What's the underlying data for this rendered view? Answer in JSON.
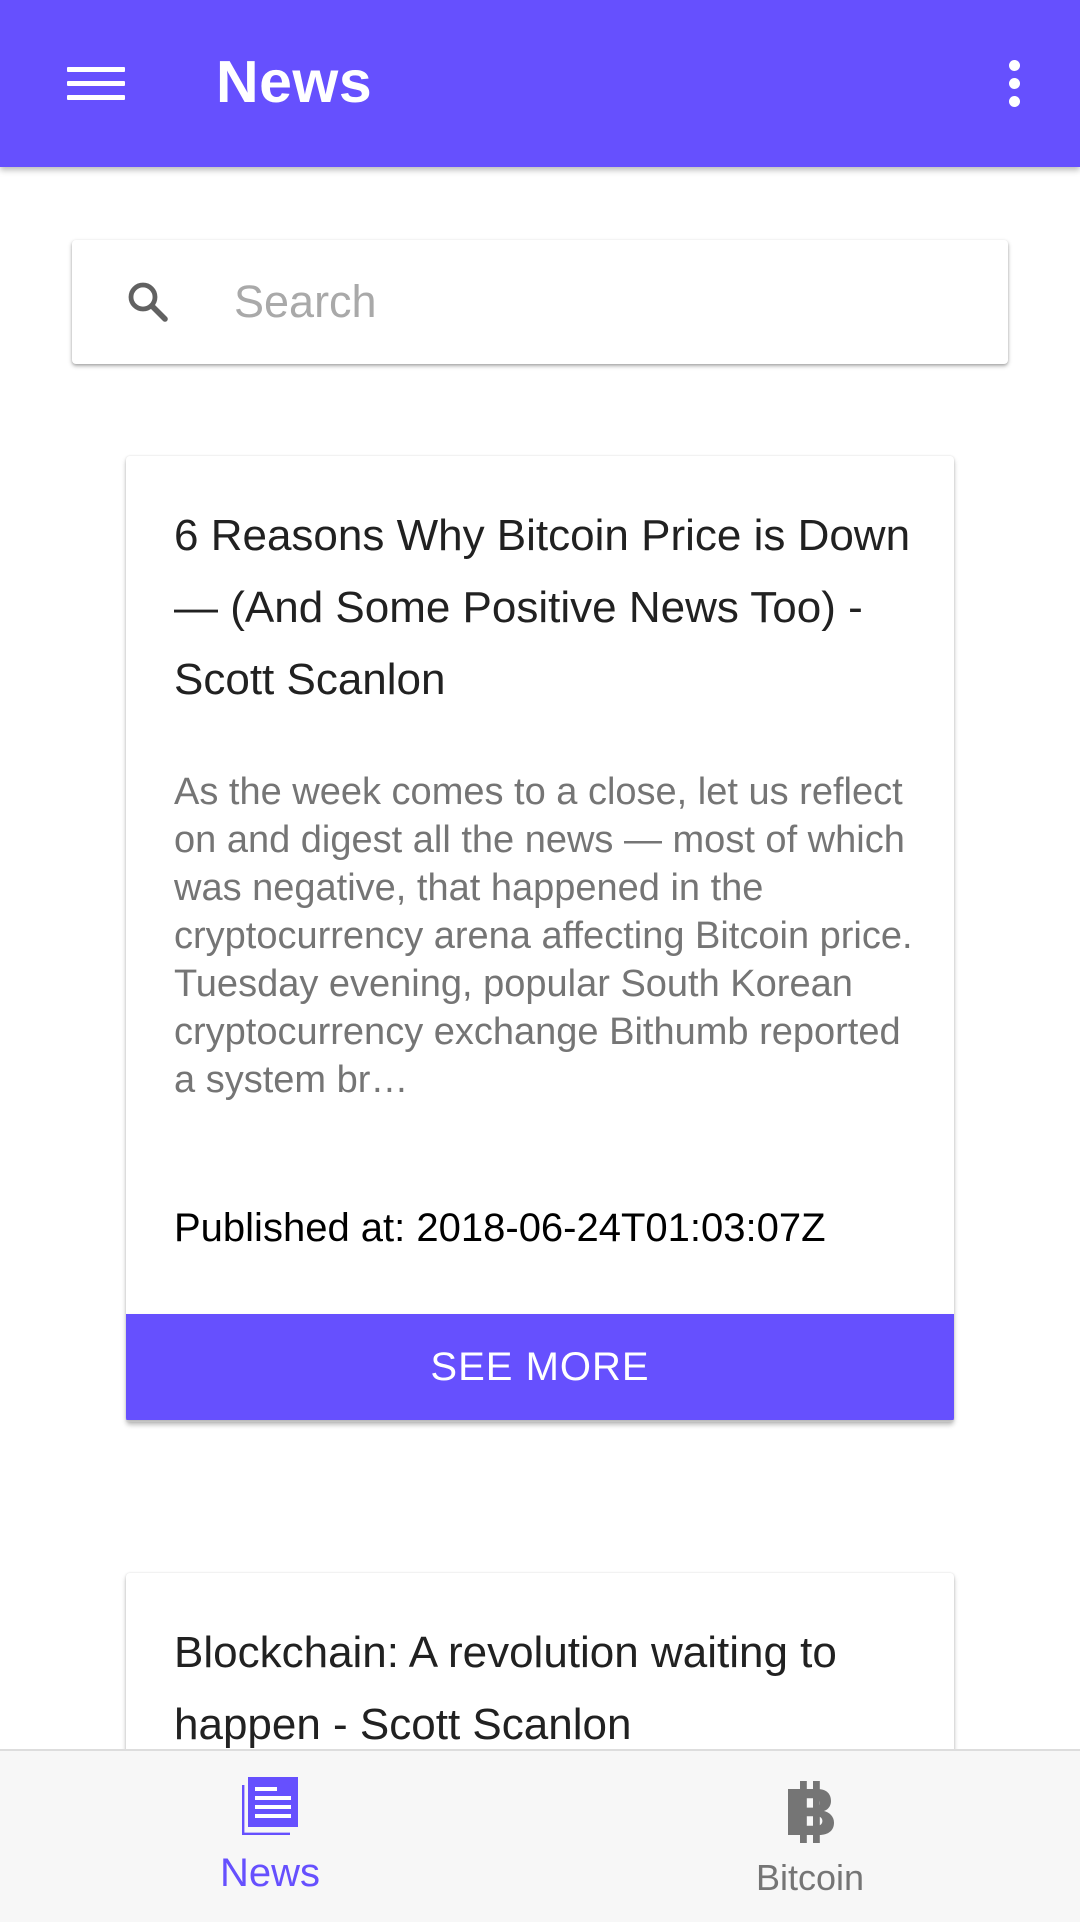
{
  "appbar": {
    "title": "News",
    "menu_icon": "menu-icon",
    "more_icon": "more-vert-icon",
    "color": "#6650fe"
  },
  "search": {
    "placeholder": "Search",
    "value": "",
    "icon": "search-icon"
  },
  "articles": [
    {
      "title": "6 Reasons Why Bitcoin Price is Down — (And Some Positive News Too) - Scott Scanlon",
      "description": "As the week comes to a close, let us reflect on and digest all the news — most of which was negative, that happened in the cryptocurrency arena affecting Bitcoin price. Tuesday evening, popular South Korean cryptocurrency exchange Bithumb reported a system br…",
      "published": "Published at: 2018-06-24T01:03:07Z",
      "button_label": "SEE MORE"
    },
    {
      "title": "Blockchain: A revolution waiting to happen - Scott Scanlon"
    }
  ],
  "bottom_nav": {
    "items": [
      {
        "label": "News",
        "icon": "article-icon",
        "active": true
      },
      {
        "label": "Bitcoin",
        "icon": "bitcoin-icon",
        "active": false
      }
    ],
    "active_color": "#6650fe",
    "inactive_color": "#757575"
  }
}
